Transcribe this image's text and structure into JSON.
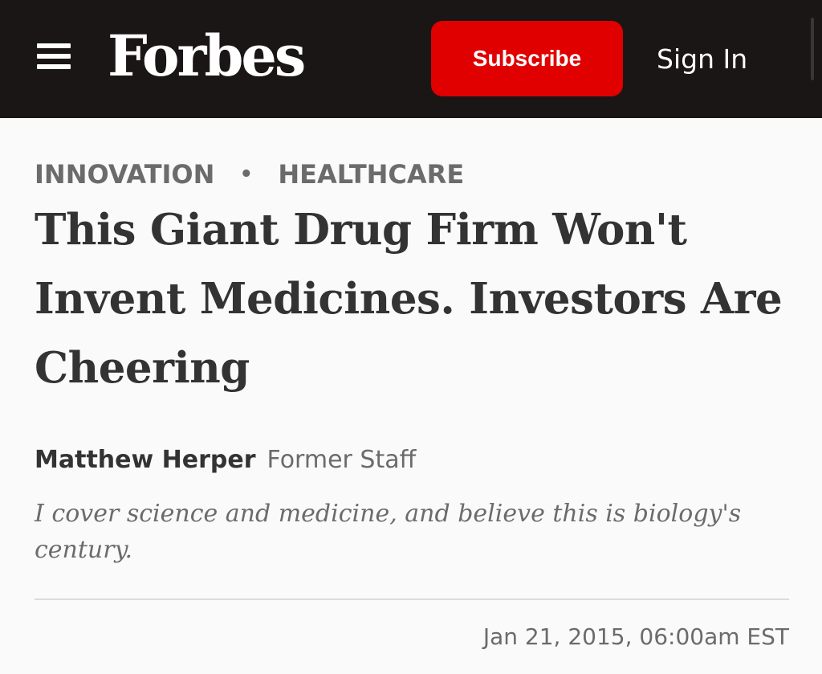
{
  "header": {
    "menu_icon": "hamburger-menu-icon",
    "logo": "Forbes",
    "subscribe_label": "Subscribe",
    "signin_label": "Sign In",
    "colors": {
      "background": "#1a1616",
      "subscribe": "#e00000"
    }
  },
  "article": {
    "categories": [
      "INNOVATION",
      "HEALTHCARE"
    ],
    "category_separator": "•",
    "title": "This Giant Drug Firm Won't Invent Medicines. Investors Are Cheering",
    "author": {
      "name": "Matthew Herper",
      "role": "Former Staff",
      "bio": "I cover science and medicine, and believe this is biology's century."
    },
    "published": "Jan 21, 2015, 06:00am EST"
  }
}
